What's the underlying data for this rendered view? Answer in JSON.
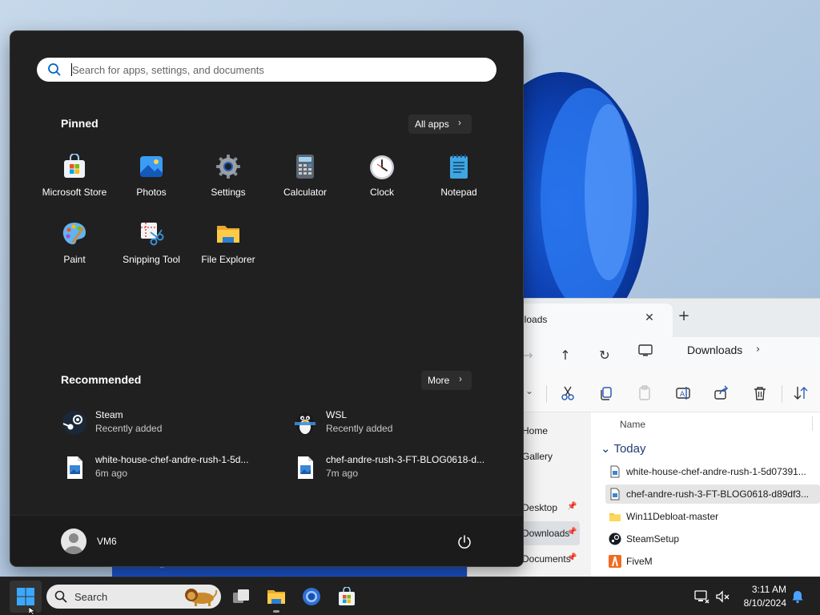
{
  "start_menu": {
    "search_placeholder": "Search for apps, settings, and documents",
    "pinned_title": "Pinned",
    "all_apps_label": "All apps",
    "pinned_apps": [
      {
        "name": "Microsoft Store",
        "icon": "microsoft-store-icon"
      },
      {
        "name": "Photos",
        "icon": "photos-icon"
      },
      {
        "name": "Settings",
        "icon": "settings-gear-icon"
      },
      {
        "name": "Calculator",
        "icon": "calculator-icon"
      },
      {
        "name": "Clock",
        "icon": "clock-icon"
      },
      {
        "name": "Notepad",
        "icon": "notepad-icon"
      },
      {
        "name": "Paint",
        "icon": "paint-palette-icon"
      },
      {
        "name": "Snipping Tool",
        "icon": "snipping-tool-icon"
      },
      {
        "name": "File Explorer",
        "icon": "folder-icon"
      }
    ],
    "recommended_title": "Recommended",
    "more_label": "More",
    "recommended": [
      {
        "title": "Steam",
        "subtitle": "Recently added",
        "icon": "steam-icon"
      },
      {
        "title": "WSL",
        "subtitle": "Recently added",
        "icon": "penguin-icon"
      },
      {
        "title": "white-house-chef-andre-rush-1-5d...",
        "subtitle": "6m ago",
        "icon": "image-file-icon"
      },
      {
        "title": "chef-andre-rush-3-FT-BLOG0618-d...",
        "subtitle": "7m ago",
        "icon": "image-file-icon"
      }
    ],
    "user_name": "VM6"
  },
  "explorer": {
    "tab_label": "Downloads",
    "breadcrumb": "Downloads",
    "column_name": "Name",
    "group": "Today",
    "nav_items": [
      {
        "label": "Home",
        "pinned": false
      },
      {
        "label": "Gallery",
        "pinned": false
      },
      {
        "label": "Desktop",
        "pinned": true
      },
      {
        "label": "Downloads",
        "pinned": true
      },
      {
        "label": "Documents",
        "pinned": true
      }
    ],
    "files": [
      {
        "name": "white-house-chef-andre-rush-1-5d07391...",
        "type": "image"
      },
      {
        "name": "chef-andre-rush-3-FT-BLOG0618-d89df3...",
        "type": "image"
      },
      {
        "name": "Win11Debloat-master",
        "type": "folder"
      },
      {
        "name": "SteamSetup",
        "type": "steam"
      },
      {
        "name": "FiveM",
        "type": "fivem"
      }
    ]
  },
  "taskbar": {
    "search_label": "Search",
    "time": "3:11 AM",
    "date": "8/10/2024"
  },
  "colors": {
    "start_bg": "#202020",
    "taskbar_bg": "#202020",
    "accent": "#0067c0"
  }
}
